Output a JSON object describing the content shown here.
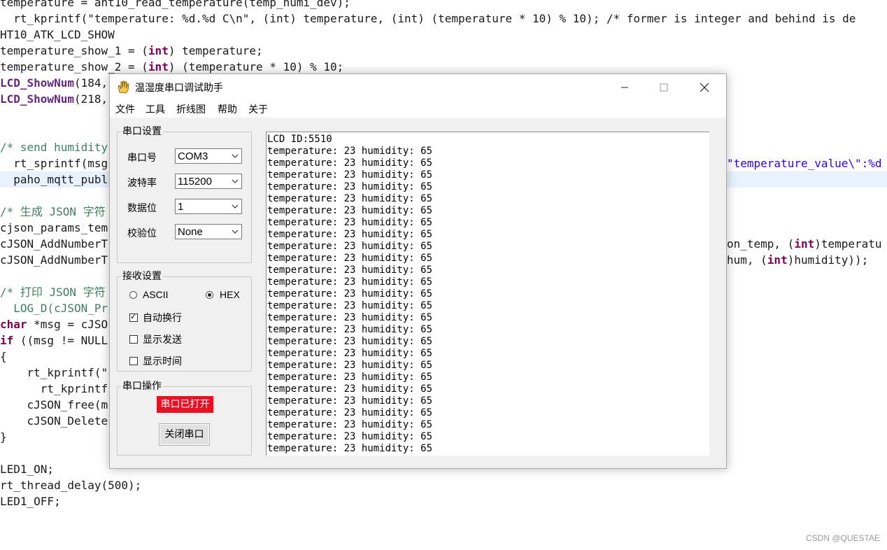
{
  "editor": {
    "left_lines": [
      {
        "segments": [
          {
            "t": "temperature = aht10_read_temperature(temp_humi_dev);",
            "c": ""
          }
        ]
      },
      {
        "segments": [
          {
            "t": "  rt_kprintf(\"temperature: %d.%d C\\n\", (int) temperature, (int) (temperature * 10) % 10); /* former is integer and behind is de",
            "c": ""
          }
        ]
      },
      {
        "segments": [
          {
            "t": "HT10_ATK_LCD_SHOW",
            "c": ""
          }
        ]
      },
      {
        "segments": [
          {
            "t": "temperature_show_1 = (",
            "c": ""
          },
          {
            "t": "int",
            "c": "kw"
          },
          {
            "t": ") temperature;",
            "c": ""
          }
        ]
      },
      {
        "segments": [
          {
            "t": "temperature_show_2 = (",
            "c": ""
          },
          {
            "t": "int",
            "c": "kw"
          },
          {
            "t": ") (temperature * 10) % 10;",
            "c": ""
          }
        ]
      },
      {
        "segments": [
          {
            "t": "LCD_ShowNum",
            "c": "fn"
          },
          {
            "t": "(184,",
            "c": ""
          }
        ]
      },
      {
        "segments": [
          {
            "t": "LCD_ShowNum",
            "c": "fn"
          },
          {
            "t": "(218,",
            "c": ""
          }
        ]
      },
      {
        "segments": [
          {
            "t": "",
            "c": ""
          }
        ]
      },
      {
        "segments": [
          {
            "t": "",
            "c": ""
          }
        ]
      },
      {
        "segments": [
          {
            "t": "/* send humidity",
            "c": "cm"
          }
        ]
      },
      {
        "segments": [
          {
            "t": "  rt_sprintf(msg",
            "c": ""
          }
        ]
      },
      {
        "segments": [
          {
            "t": "  paho_mqtt_publ",
            "c": ""
          }
        ],
        "hl": true
      },
      {
        "segments": [
          {
            "t": "",
            "c": ""
          }
        ]
      },
      {
        "segments": [
          {
            "t": "/* 生成 JSON 字符",
            "c": "cm"
          }
        ]
      },
      {
        "segments": [
          {
            "t": "cjson_params_tem",
            "c": ""
          }
        ]
      },
      {
        "segments": [
          {
            "t": "cJSON_AddNumberT",
            "c": ""
          }
        ]
      },
      {
        "segments": [
          {
            "t": "cJSON_AddNumberT",
            "c": ""
          }
        ]
      },
      {
        "segments": [
          {
            "t": "",
            "c": ""
          }
        ]
      },
      {
        "segments": [
          {
            "t": "/* 打印 JSON 字符",
            "c": "cm"
          }
        ]
      },
      {
        "segments": [
          {
            "t": "  LOG_D(cJSON_Pr",
            "c": "cm"
          }
        ]
      },
      {
        "segments": [
          {
            "t": "char",
            "c": "kw"
          },
          {
            "t": " *msg = cJSO",
            "c": ""
          }
        ]
      },
      {
        "segments": [
          {
            "t": "if",
            "c": "kw"
          },
          {
            "t": " ((msg != NULL",
            "c": ""
          }
        ]
      },
      {
        "segments": [
          {
            "t": "{",
            "c": ""
          }
        ]
      },
      {
        "segments": [
          {
            "t": "    rt_kprintf(\"",
            "c": ""
          }
        ]
      },
      {
        "segments": [
          {
            "t": "      rt_kprintf",
            "c": ""
          }
        ]
      },
      {
        "segments": [
          {
            "t": "    cJSON_free(m",
            "c": ""
          }
        ]
      },
      {
        "segments": [
          {
            "t": "    cJSON_Delete",
            "c": ""
          }
        ]
      },
      {
        "segments": [
          {
            "t": "}",
            "c": ""
          }
        ]
      },
      {
        "segments": [
          {
            "t": "",
            "c": ""
          }
        ]
      },
      {
        "segments": [
          {
            "t": "LED1_ON;",
            "c": ""
          }
        ]
      },
      {
        "segments": [
          {
            "t": "rt_thread_delay(500);",
            "c": ""
          }
        ]
      },
      {
        "segments": [
          {
            "t": "LED1_OFF;",
            "c": ""
          }
        ]
      }
    ],
    "right_fragments": [
      {
        "segments": [
          {
            "t": "\"temperature_value\\\":%d",
            "c": "st"
          }
        ]
      },
      {
        "segments": [
          {
            "t": "on_temp, (",
            "c": ""
          },
          {
            "t": "int",
            "c": "kw"
          },
          {
            "t": ")temperatu",
            "c": ""
          }
        ]
      },
      {
        "segments": [
          {
            "t": "hum, (",
            "c": ""
          },
          {
            "t": "int",
            "c": "kw"
          },
          {
            "t": ")humidity));",
            "c": ""
          }
        ]
      }
    ],
    "watermark": "CSDN @QUESTAE"
  },
  "window": {
    "title": "温湿度串口调试助手",
    "menu": [
      "文件",
      "工具",
      "折线图",
      "帮助",
      "关于"
    ],
    "serial_settings": {
      "title": "串口设置",
      "fields": [
        {
          "label": "串口号",
          "value": "COM3"
        },
        {
          "label": "波特率",
          "value": "115200"
        },
        {
          "label": "数据位",
          "value": "1"
        },
        {
          "label": "校验位",
          "value": "None"
        }
      ]
    },
    "receive_settings": {
      "title": "接收设置",
      "radios": [
        {
          "label": "ASCII",
          "checked": false
        },
        {
          "label": "HEX",
          "checked": true
        }
      ],
      "checkboxes": [
        {
          "label": "自动换行",
          "checked": true
        },
        {
          "label": "显示发送",
          "checked": false
        },
        {
          "label": "显示时间",
          "checked": false
        }
      ]
    },
    "serial_ops": {
      "title": "串口操作",
      "status": "串口已打开",
      "status_color": "#e81123",
      "button": "关闭串口"
    },
    "receive_lines": [
      "LCD ID:5510",
      "temperature: 23 humidity: 65",
      "temperature: 23 humidity: 65",
      "temperature: 23 humidity: 65",
      "temperature: 23 humidity: 65",
      "temperature: 23 humidity: 65",
      "temperature: 23 humidity: 65",
      "temperature: 23 humidity: 65",
      "temperature: 23 humidity: 65",
      "temperature: 23 humidity: 65",
      "temperature: 23 humidity: 65",
      "temperature: 23 humidity: 65",
      "temperature: 23 humidity: 65",
      "temperature: 23 humidity: 65",
      "temperature: 23 humidity: 65",
      "temperature: 23 humidity: 65",
      "temperature: 23 humidity: 65",
      "temperature: 23 humidity: 65",
      "temperature: 23 humidity: 65",
      "temperature: 23 humidity: 65",
      "temperature: 23 humidity: 65",
      "temperature: 23 humidity: 65",
      "temperature: 23 humidity: 65",
      "temperature: 23 humidity: 65",
      "temperature: 23 humidity: 65",
      "temperature: 23 humidity: 65",
      "temperature: 23 humidity: 65",
      "temperature: 23 humidity: 65"
    ]
  }
}
